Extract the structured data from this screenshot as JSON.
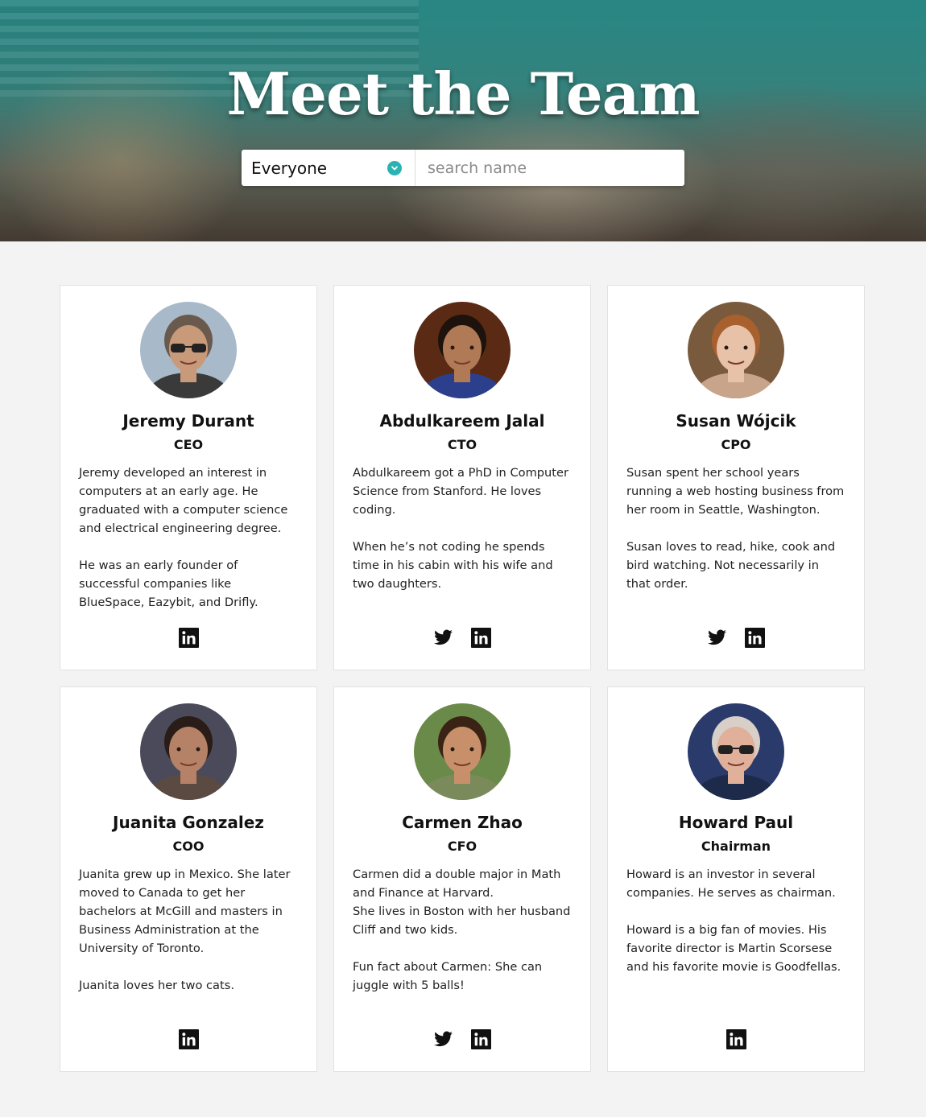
{
  "header": {
    "title": "Meet the Team",
    "filter_selected": "Everyone",
    "search_placeholder": "search name"
  },
  "colors": {
    "accent": "#2bb3b1",
    "page_bg": "#f3f3f3"
  },
  "team": [
    {
      "name": "Jeremy Durant",
      "role": "CEO",
      "bio": [
        "Jeremy developed an interest in computers at an early age. He graduated with a computer science and electrical engineering degree.",
        "He was an early founder of successful companies like BlueSpace, Eazybit, and Drifly."
      ],
      "socials": [
        "linkedin-icon"
      ]
    },
    {
      "name": "Abdulkareem Jalal",
      "role": "CTO",
      "bio": [
        "Abdulkareem got a PhD in Computer Science from Stanford. He loves coding.",
        "When he’s not coding he spends time in his cabin with his wife and two daughters."
      ],
      "socials": [
        "twitter-icon",
        "linkedin-icon"
      ]
    },
    {
      "name": "Susan Wójcik",
      "role": "CPO",
      "bio": [
        "Susan spent her school years running a web hosting business from her room in Seattle, Washington.",
        "Susan loves to read, hike, cook and bird watching. Not necessarily in that order."
      ],
      "socials": [
        "twitter-icon",
        "linkedin-icon"
      ]
    },
    {
      "name": "Juanita Gonzalez",
      "role": "COO",
      "bio": [
        "Juanita grew up in Mexico. She later moved to Canada to get her bachelors at McGill and masters in Business Administration at the University of Toronto.",
        "Juanita loves her two cats."
      ],
      "socials": [
        "linkedin-icon"
      ]
    },
    {
      "name": "Carmen Zhao",
      "role": "CFO",
      "bio": [
        "Carmen did a double major in Math and Finance at Harvard.\nShe lives in Boston with her husband Cliff and two kids.",
        "Fun fact about Carmen: She can juggle with 5 balls!"
      ],
      "socials": [
        "twitter-icon",
        "linkedin-icon"
      ]
    },
    {
      "name": "Howard Paul",
      "role": "Chairman",
      "bio": [
        "Howard is an investor in several companies. He serves as chairman.",
        "Howard is a big fan of movies. His favorite director is Martin Scorsese and his favorite movie is Goodfellas."
      ],
      "socials": [
        "linkedin-icon"
      ]
    }
  ]
}
